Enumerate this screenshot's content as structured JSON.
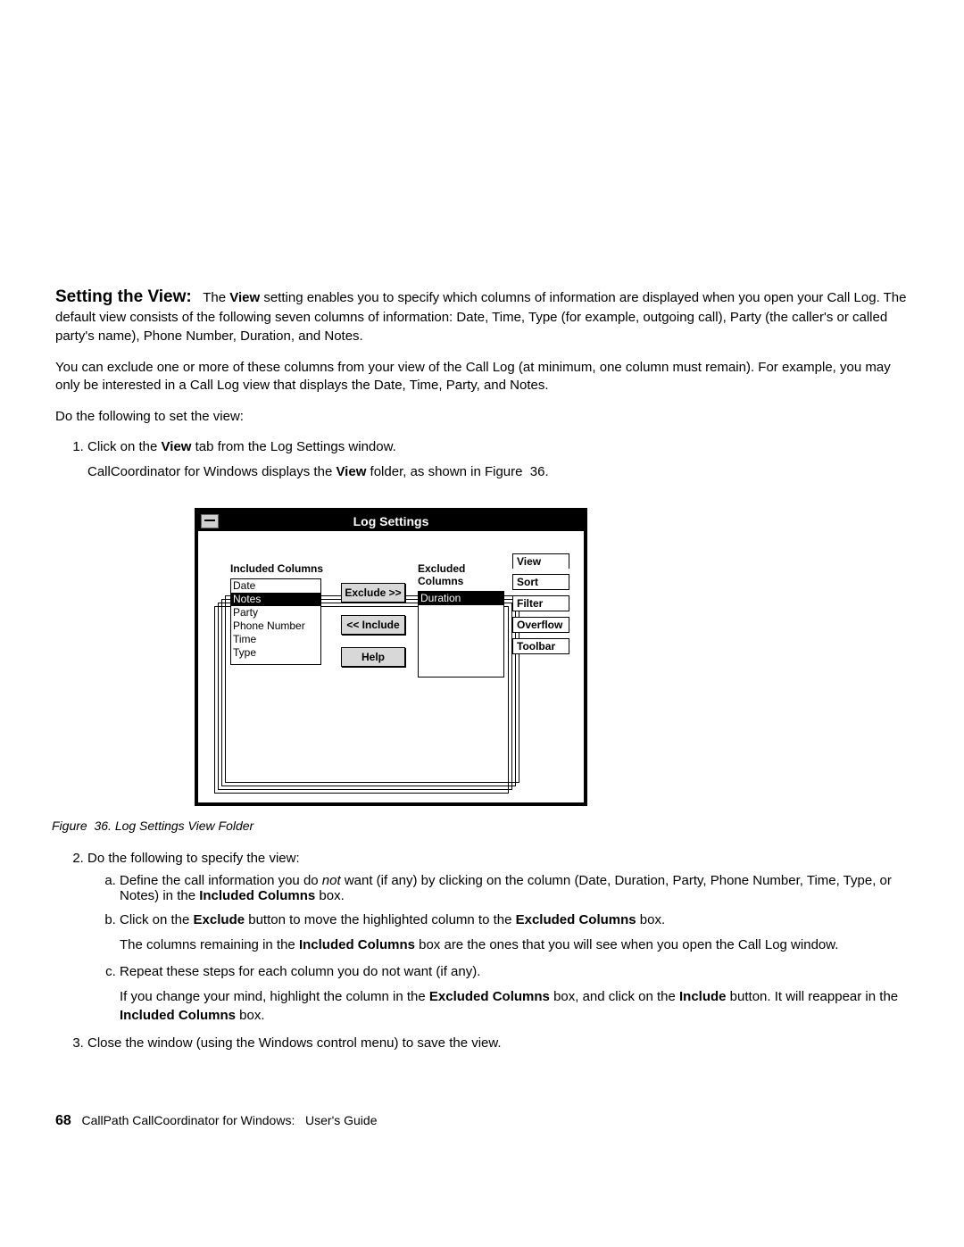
{
  "intro": {
    "headline": "Setting the View:",
    "body_after_headline": "   The ",
    "view_strong": "View",
    "body_rest": " setting enables you to specify which columns of information are displayed when you open your Call Log.  The default view consists of the following seven columns of information:  Date, Time, Type (for example, outgoing call), Party (the caller's or called party's name), Phone Number, Duration, and Notes."
  },
  "p2": "You can exclude one or more of these columns from your view of the Call Log (at minimum, one column must remain).  For example, you may only be interested in a Call Log view that displays the Date, Time, Party, and Notes.",
  "p3": "Do the following to set the view:",
  "step1_a": "Click on the ",
  "step1_view": "View",
  "step1_b": " tab from the Log Settings window.",
  "step1_sub_a": "CallCoordinator for Windows displays the ",
  "step1_sub_view": "View",
  "step1_sub_b": " folder, as shown in Figure  36.",
  "shot": {
    "title": "Log Settings",
    "included_label": "Included Columns",
    "excluded_label": "Excluded Columns",
    "included_items": [
      "Date",
      "Notes",
      "Party",
      "Phone Number",
      "Time",
      "Type"
    ],
    "included_selected_index": 1,
    "excluded_items": [
      "Duration"
    ],
    "excluded_selected_index": 0,
    "btn_exclude": "Exclude >>",
    "btn_include": "<< Include",
    "btn_help": "Help",
    "tabs": [
      "View",
      "Sort",
      "Filter",
      "Overflow",
      "Toolbar"
    ]
  },
  "figcaption": "Figure  36.  Log Settings View Folder",
  "step2_lead": "Do the following to specify the view:",
  "step2a_a": "Define the call information you do ",
  "step2a_not": "not",
  "step2a_b": " want (if any) by clicking on the column (Date, Duration, Party, Phone Number, Time, Type, or Notes) in the ",
  "step2a_inc_strong": "Included Columns",
  "step2a_c": " box.",
  "step2b_a": "Click on the ",
  "step2b_excl_strong": "Exclude",
  "step2b_b": " button to move the highlighted column to the ",
  "step2b_exclcol_strong": "Excluded Columns",
  "step2b_c": " box.",
  "step2b_sub_a": "The columns remaining in the ",
  "step2b_sub_inc": "Included Columns",
  "step2b_sub_b": " box are the ones that you will see when you open the Call Log window.",
  "step2c": "Repeat these steps for each column you do not want (if any).",
  "step2c_sub_a": "If you change your mind, highlight the column in the ",
  "step2c_sub_exclcol": "Excluded Columns",
  "step2c_sub_b": " box, and click on the ",
  "step2c_sub_include": "Include",
  "step2c_sub_c": " button.  It will reappear in the ",
  "step2c_sub_inccol": "Included Columns",
  "step2c_sub_d": " box.",
  "step3": "Close the window (using the Windows control menu) to save the view.",
  "footer_page": "68",
  "footer_text": "   CallPath CallCoordinator for Windows:   User's Guide"
}
